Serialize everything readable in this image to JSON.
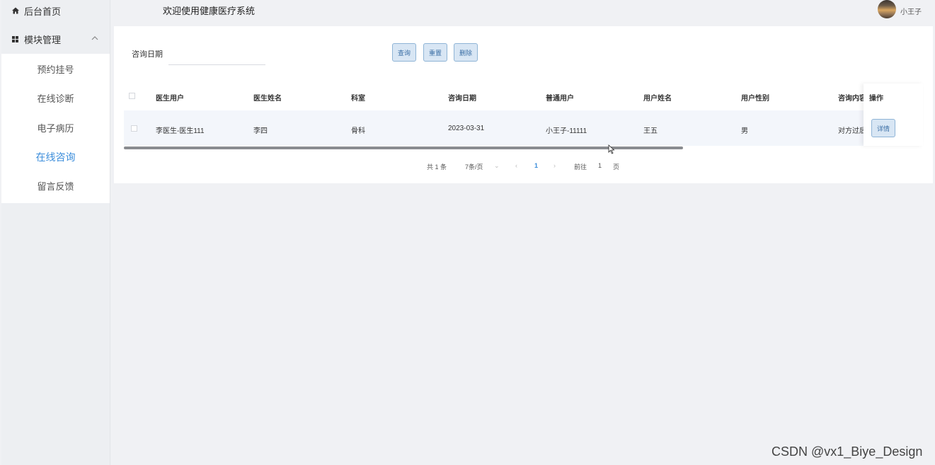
{
  "sidebar": {
    "home_label": "后台首页",
    "group_label": "模块管理",
    "items": [
      {
        "label": "预约挂号",
        "active": false
      },
      {
        "label": "在线诊断",
        "active": false
      },
      {
        "label": "电子病历",
        "active": false
      },
      {
        "label": "在线咨询",
        "active": true
      },
      {
        "label": "留言反馈",
        "active": false
      }
    ]
  },
  "header": {
    "title": "欢迎使用健康医疗系统",
    "username": "小王子"
  },
  "search": {
    "label": "咨询日期",
    "value": "",
    "buttons": {
      "query": "查询",
      "reset": "重置",
      "delete": "删除"
    }
  },
  "table": {
    "headers": [
      "医生用户",
      "医生姓名",
      "科室",
      "咨询日期",
      "普通用户",
      "用户姓名",
      "用户性别",
      "咨询内容",
      "操作"
    ],
    "rows": [
      {
        "cells": [
          "李医生-医生111",
          "李四",
          "骨科",
          "2023-03-31",
          "小王子-11111",
          "王五",
          "男",
          "对方过后"
        ],
        "action": "详情"
      }
    ],
    "scroll_fraction": 0.7
  },
  "pagination": {
    "total": "共 1 条",
    "page_size": "7条/页",
    "current_page": "1",
    "goto_label": "前往",
    "goto_value": "1",
    "page_suffix": "页"
  },
  "watermark": "CSDN @vx1_Biye_Design",
  "colors": {
    "accent": "#3b8ddb",
    "button_bg": "#d8e6f4",
    "button_border": "#8fb4d6"
  }
}
